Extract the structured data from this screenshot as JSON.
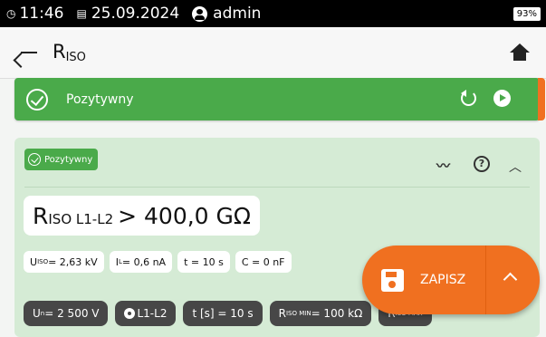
{
  "status_bar": {
    "time": "11:46",
    "date": "25.09.2024",
    "user": "admin",
    "battery": "93%"
  },
  "header": {
    "title_main": "R",
    "title_sub": "ISO"
  },
  "result": {
    "status": "Pozytywny",
    "color": "#4aaa4a"
  },
  "card": {
    "badge": "Pozytywny",
    "main_value": {
      "symbol": "R",
      "sub": "ISO L1-L2",
      "value": "> 400,0 GΩ"
    },
    "params": [
      {
        "symbol": "U",
        "sub": "ISO",
        "value": " = 2,63 kV"
      },
      {
        "symbol": "I",
        "sub": "L",
        "value": " = 0,6 nA"
      },
      {
        "symbol": "",
        "sub": "",
        "value": "t = 10 s"
      },
      {
        "symbol": "",
        "sub": "",
        "value": "C = 0 nF"
      }
    ],
    "settings": [
      {
        "symbol": "U",
        "sub": "n",
        "value": " = 2 500 V"
      },
      {
        "symbol": "",
        "sub": "",
        "value": "L1-L2"
      },
      {
        "symbol": "",
        "sub": "",
        "value": "t [s] = 10 s"
      },
      {
        "symbol": "R",
        "sub": "ISO MIN",
        "value": " = 100 kΩ"
      },
      {
        "symbol": "R",
        "sub": "ISO MAX",
        "value": ""
      }
    ]
  },
  "save_button": {
    "label": "ZAPISZ",
    "color": "#f07020"
  },
  "icons": [
    "back-arrow-icon",
    "home-icon",
    "check-circle-icon",
    "replay-icon",
    "play-icon",
    "trend-icon",
    "help-icon",
    "chevron-up-icon",
    "floppy-icon"
  ]
}
